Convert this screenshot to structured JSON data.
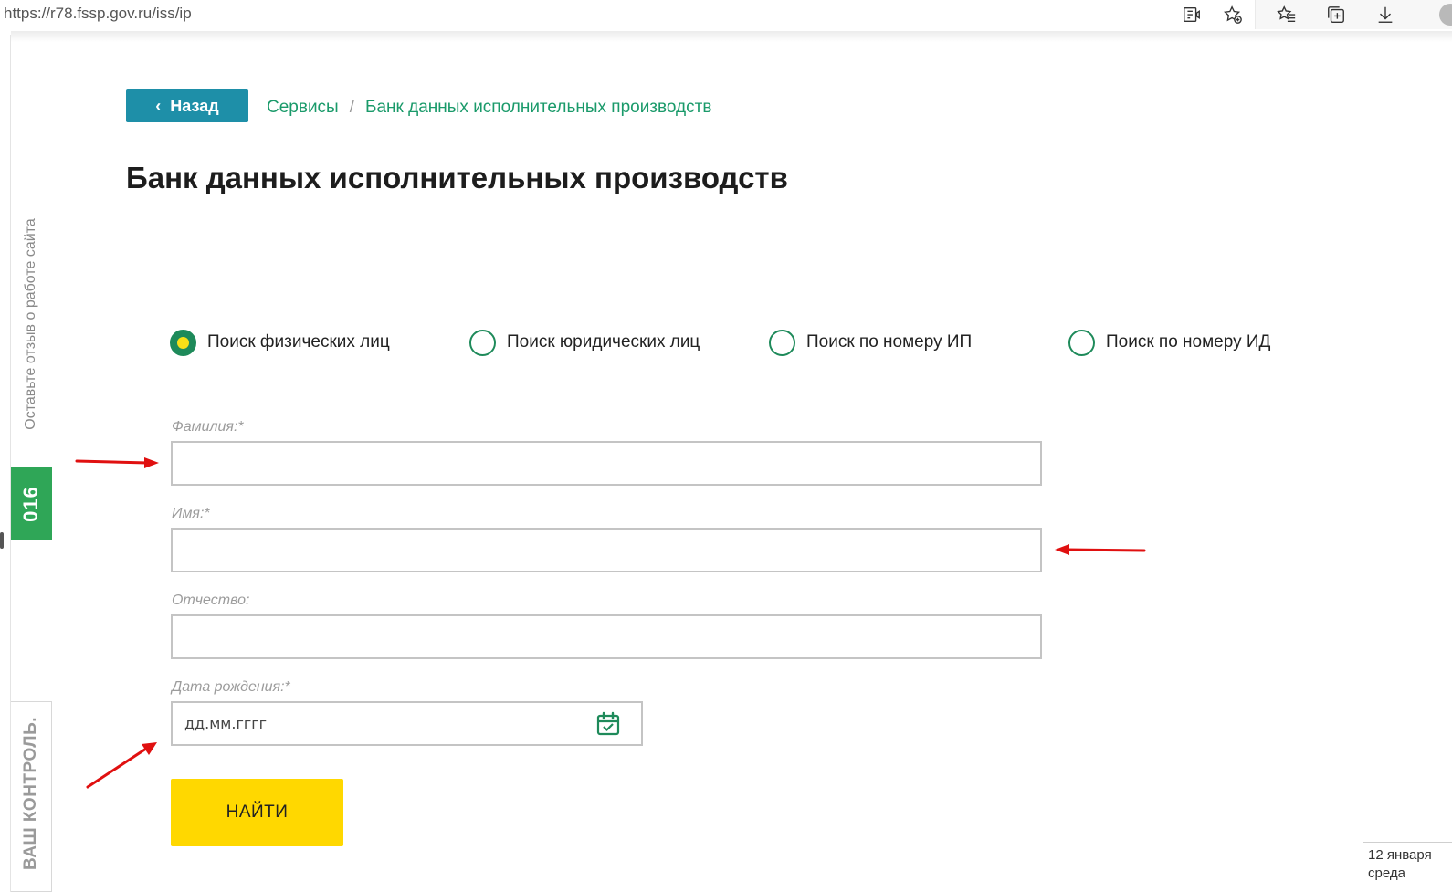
{
  "browser": {
    "url": "https://r78.fssp.gov.ru/iss/ip",
    "icons": [
      "reader-view-icon",
      "add-favorite-icon",
      "favorites-icon",
      "collections-icon",
      "download-icon"
    ]
  },
  "side_tabs": {
    "feedback": "Оставьте отзыв о работе сайта",
    "green_label": "016",
    "control": "ВАШ КОНТРОЛЬ."
  },
  "nav": {
    "back_label": "Назад",
    "breadcrumb": [
      "Сервисы",
      "Банк данных исполнительных производств"
    ],
    "breadcrumb_sep": "/"
  },
  "page": {
    "title": "Банк данных исполнительных производств"
  },
  "search_types": [
    {
      "label": "Поиск физических лиц",
      "checked": true
    },
    {
      "label": "Поиск юридических лиц",
      "checked": false
    },
    {
      "label": "Поиск по номеру ИП",
      "checked": false
    },
    {
      "label": "Поиск по номеру ИД",
      "checked": false
    }
  ],
  "form": {
    "lastname_label": "Фамилия:*",
    "lastname_value": "",
    "firstname_label": "Имя:*",
    "firstname_value": "",
    "patronymic_label": "Отчество:",
    "patronymic_value": "",
    "birthdate_label": "Дата рождения:*",
    "birthdate_placeholder": "дд.мм.гггг",
    "submit_label": "НАЙТИ"
  },
  "clock": {
    "date": "12 января",
    "weekday": "среда"
  },
  "colors": {
    "accent_teal": "#1e8fa8",
    "link_green": "#1a9a6a",
    "radio_green": "#1e8a5a",
    "submit_yellow": "#ffd800",
    "annotation_red": "#e01010"
  }
}
